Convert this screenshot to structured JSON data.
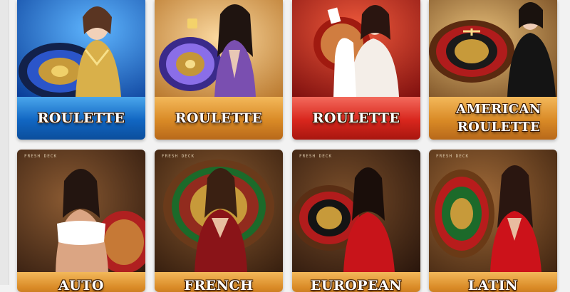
{
  "games": [
    {
      "title": "ROULETTE",
      "label_color": "blue"
    },
    {
      "title": "ROULETTE",
      "label_color": "orange"
    },
    {
      "title": "ROULETTE",
      "label_color": "red"
    },
    {
      "title": "AMERICAN ROULETTE",
      "label_color": "orange"
    },
    {
      "title": "AUTO",
      "label_color": "orange",
      "studio": "FRESH DECK"
    },
    {
      "title": "FRENCH",
      "label_color": "orange",
      "studio": "FRESH DECK"
    },
    {
      "title": "EUROPEAN",
      "label_color": "orange",
      "studio": "FRESH DECK"
    },
    {
      "title": "LATIN",
      "label_color": "orange",
      "studio": "FRESH DECK"
    }
  ],
  "colors": {
    "label_blue": "#1166c2",
    "label_orange": "#d98a26",
    "label_red": "#d8261d",
    "page_background": "#f2f2f2"
  },
  "icons": [
    "roulette-wheel",
    "dealer-portrait"
  ]
}
